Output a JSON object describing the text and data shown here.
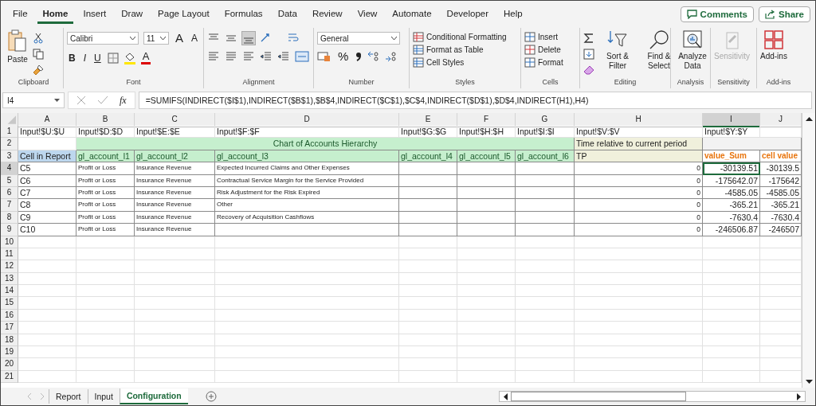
{
  "menu": {
    "tabs": [
      {
        "label": "File",
        "selected": false
      },
      {
        "label": "Home",
        "selected": true
      },
      {
        "label": "Insert",
        "selected": false
      },
      {
        "label": "Draw",
        "selected": false
      },
      {
        "label": "Page Layout",
        "selected": false
      },
      {
        "label": "Formulas",
        "selected": false
      },
      {
        "label": "Data",
        "selected": false
      },
      {
        "label": "Review",
        "selected": false
      },
      {
        "label": "View",
        "selected": false
      },
      {
        "label": "Automate",
        "selected": false
      },
      {
        "label": "Developer",
        "selected": false
      },
      {
        "label": "Help",
        "selected": false
      }
    ],
    "comments": "Comments",
    "share": "Share"
  },
  "ribbon": {
    "clipboard": {
      "paste": "Paste",
      "label": "Clipboard"
    },
    "font": {
      "name": "Calibri",
      "size": "11",
      "grow": "A",
      "shrink": "A",
      "bold": "B",
      "italic": "I",
      "underline": "U",
      "font_color_button": "A",
      "label": "Font"
    },
    "alignment": {
      "label": "Alignment"
    },
    "number": {
      "format": "General",
      "percent": "%",
      "label": "Number"
    },
    "styles": {
      "items": [
        "Conditional Formatting",
        "Format as Table",
        "Cell Styles"
      ],
      "label": "Styles"
    },
    "cells": {
      "items": [
        "Insert",
        "Delete",
        "Format"
      ],
      "label": "Cells"
    },
    "editing": {
      "sort": "Sort & Filter",
      "find": "Find & Select",
      "label": "Editing"
    },
    "analysis": {
      "button": "Analyze Data",
      "label": "Analysis"
    },
    "sensitivity": {
      "button": "Sensitivity",
      "disabled": true,
      "label": "Sensitivity"
    },
    "addins": {
      "button": "Add-ins",
      "label": "Add-ins"
    }
  },
  "formula_bar": {
    "name_box": "I4",
    "fx": "fx",
    "formula": "=SUMIFS(INDIRECT($I$1),INDIRECT($B$1),$B$4,INDIRECT($C$1),$C$4,INDIRECT($D$1),$D$4,INDIRECT(H1),H4)"
  },
  "sheet": {
    "columns": [
      {
        "label": "A",
        "selected": false
      },
      {
        "label": "B",
        "selected": false
      },
      {
        "label": "C",
        "selected": false
      },
      {
        "label": "D",
        "selected": false
      },
      {
        "label": "E",
        "selected": false
      },
      {
        "label": "F",
        "selected": false
      },
      {
        "label": "G",
        "selected": false
      },
      {
        "label": "H",
        "selected": false
      },
      {
        "label": "I",
        "selected": true
      },
      {
        "label": "J",
        "selected": false
      }
    ],
    "rows": [
      {
        "number": "1",
        "selected": false,
        "table": false,
        "cells": [
          {
            "text": "Input!$U:$U",
            "kind": "plain"
          },
          {
            "text": "Input!$D:$D",
            "kind": "plain"
          },
          {
            "text": "Input!$E:$E",
            "kind": "plain"
          },
          {
            "text": "Input!$F:$F",
            "kind": "plain"
          },
          {
            "text": "Input!$G:$G",
            "kind": "plain"
          },
          {
            "text": "Input!$H:$H",
            "kind": "plain"
          },
          {
            "text": "Input!$I:$I",
            "kind": "plain"
          },
          {
            "text": "Input!$V:$V",
            "kind": "plain"
          },
          {
            "text": "Input!$Y:$Y",
            "kind": "plain"
          },
          null
        ]
      },
      {
        "number": "2",
        "selected": false,
        "table": false,
        "cells": [
          null,
          {
            "text": "Chart of Accounts Hierarchy",
            "kind": "hierarchy_title"
          },
          {
            "merged": true
          },
          {
            "merged": true
          },
          {
            "merged": true
          },
          {
            "merged": true
          },
          {
            "merged": true
          },
          {
            "text": "Time relative to current period",
            "kind": "time"
          },
          {
            "kind": "fill"
          },
          {
            "merged": true
          }
        ]
      },
      {
        "number": "3",
        "selected": false,
        "table": true,
        "cells": [
          {
            "text": "Cell in Report",
            "kind": "key"
          },
          {
            "text": "gl_account_l1",
            "kind": "hierarchy"
          },
          {
            "text": "gl_account_l2",
            "kind": "hierarchy"
          },
          {
            "text": "gl_account_l3",
            "kind": "hierarchy"
          },
          {
            "text": "gl_account_l4",
            "kind": "hierarchy"
          },
          {
            "text": "gl_account_l5",
            "kind": "hierarchy"
          },
          {
            "text": "gl_account_l6",
            "kind": "hierarchy"
          },
          {
            "text": "TP",
            "kind": "time"
          },
          {
            "text": "value_Sum",
            "kind": "measure"
          },
          {
            "text": "cell value",
            "kind": "measure"
          }
        ]
      },
      {
        "number": "4",
        "selected": true,
        "table": true,
        "cells": [
          {
            "text": "C5",
            "kind": "plain"
          },
          {
            "text": "Profit or Loss",
            "kind": "label"
          },
          {
            "text": "Insurance Revenue",
            "kind": "label"
          },
          {
            "text": "Expected Incurred Claims and Other Expenses",
            "kind": "label"
          },
          null,
          null,
          null,
          {
            "text": "0",
            "kind": "small_number"
          },
          {
            "text": "-30139.51",
            "kind": "number"
          },
          {
            "text": "-30139.5",
            "kind": "number"
          }
        ]
      },
      {
        "number": "5",
        "selected": false,
        "table": true,
        "cells": [
          {
            "text": "C6",
            "kind": "plain"
          },
          {
            "text": "Profit or Loss",
            "kind": "label"
          },
          {
            "text": "Insurance Revenue",
            "kind": "label"
          },
          {
            "text": "Contractual Service Margin for the Service Provided",
            "kind": "label"
          },
          null,
          null,
          null,
          {
            "text": "0",
            "kind": "small_number"
          },
          {
            "text": "-175642.07",
            "kind": "number"
          },
          {
            "text": "-175642",
            "kind": "number"
          }
        ]
      },
      {
        "number": "6",
        "selected": false,
        "table": true,
        "cells": [
          {
            "text": "C7",
            "kind": "plain"
          },
          {
            "text": "Profit or Loss",
            "kind": "label"
          },
          {
            "text": "Insurance Revenue",
            "kind": "label"
          },
          {
            "text": "Risk Adjustment for the Risk Expired",
            "kind": "label"
          },
          null,
          null,
          null,
          {
            "text": "0",
            "kind": "small_number"
          },
          {
            "text": "-4585.05",
            "kind": "number"
          },
          {
            "text": "-4585.05",
            "kind": "number"
          }
        ]
      },
      {
        "number": "7",
        "selected": false,
        "table": true,
        "cells": [
          {
            "text": "C8",
            "kind": "plain"
          },
          {
            "text": "Profit or Loss",
            "kind": "label"
          },
          {
            "text": "Insurance Revenue",
            "kind": "label"
          },
          {
            "text": "Other",
            "kind": "label"
          },
          null,
          null,
          null,
          {
            "text": "0",
            "kind": "small_number"
          },
          {
            "text": "-365.21",
            "kind": "number"
          },
          {
            "text": "-365.21",
            "kind": "number"
          }
        ]
      },
      {
        "number": "8",
        "selected": false,
        "table": true,
        "cells": [
          {
            "text": "C9",
            "kind": "plain"
          },
          {
            "text": "Profit or Loss",
            "kind": "label"
          },
          {
            "text": "Insurance Revenue",
            "kind": "label"
          },
          {
            "text": "Recovery of Acquisition Cashflows",
            "kind": "label"
          },
          null,
          null,
          null,
          {
            "text": "0",
            "kind": "small_number"
          },
          {
            "text": "-7630.4",
            "kind": "number"
          },
          {
            "text": "-7630.4",
            "kind": "number"
          }
        ]
      },
      {
        "number": "9",
        "selected": false,
        "table": true,
        "cells": [
          {
            "text": "C10",
            "kind": "plain"
          },
          {
            "text": "Profit or Loss",
            "kind": "label"
          },
          {
            "text": "Insurance Revenue",
            "kind": "label"
          },
          null,
          null,
          null,
          null,
          {
            "text": "0",
            "kind": "small_number"
          },
          {
            "text": "-246506.87",
            "kind": "number"
          },
          {
            "text": "-246507",
            "kind": "number"
          }
        ]
      },
      {
        "number": "10",
        "selected": false,
        "table": false
      },
      {
        "number": "11",
        "selected": false,
        "table": false
      },
      {
        "number": "12",
        "selected": false,
        "table": false
      },
      {
        "number": "13",
        "selected": false,
        "table": false
      },
      {
        "number": "14",
        "selected": false,
        "table": false
      },
      {
        "number": "15",
        "selected": false,
        "table": false
      },
      {
        "number": "16",
        "selected": false,
        "table": false
      },
      {
        "number": "17",
        "selected": false,
        "table": false
      },
      {
        "number": "18",
        "selected": false,
        "table": false
      },
      {
        "number": "19",
        "selected": false,
        "table": false
      },
      {
        "number": "20",
        "selected": false,
        "table": false
      },
      {
        "number": "21",
        "selected": false,
        "table": false
      }
    ]
  },
  "sheet_tabs": [
    {
      "label": "Report",
      "selected": false
    },
    {
      "label": "Input",
      "selected": false
    },
    {
      "label": "Configuration",
      "selected": true
    }
  ]
}
